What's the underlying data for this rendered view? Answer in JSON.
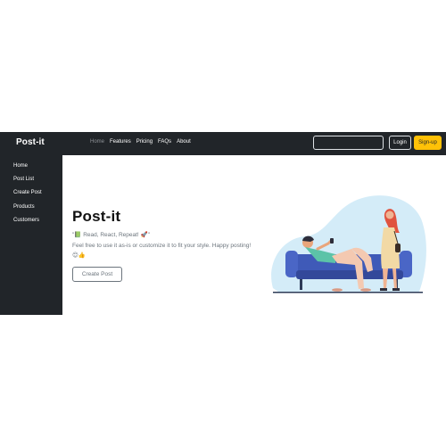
{
  "navbar": {
    "brand": "Post-it",
    "links": [
      {
        "label": "Home",
        "active": true
      },
      {
        "label": "Features",
        "active": false
      },
      {
        "label": "Pricing",
        "active": false
      },
      {
        "label": "FAQs",
        "active": false
      },
      {
        "label": "About",
        "active": false
      }
    ],
    "search_value": "",
    "login_label": "Login",
    "signup_label": "Sign-up"
  },
  "sidebar": {
    "items": [
      {
        "label": "Home"
      },
      {
        "label": "Post List"
      },
      {
        "label": "Create Post"
      },
      {
        "label": "Products"
      },
      {
        "label": "Customers"
      }
    ]
  },
  "hero": {
    "title": "Post-it",
    "tagline": "\"📗 Read, React, Repeat! 🚀\"",
    "description": "Feel free to use it as-is or customize it to fit your style. Happy posting! 😊👍",
    "create_button_label": "Create Post"
  },
  "colors": {
    "dark": "#212529",
    "accent_yellow": "#ffc107",
    "muted_text": "#6c757d",
    "illustration_blob": "#d4ecf8",
    "sofa_blue": "#3f5ab8"
  },
  "icons": [
    "sofa-illustration",
    "person-illustration"
  ]
}
